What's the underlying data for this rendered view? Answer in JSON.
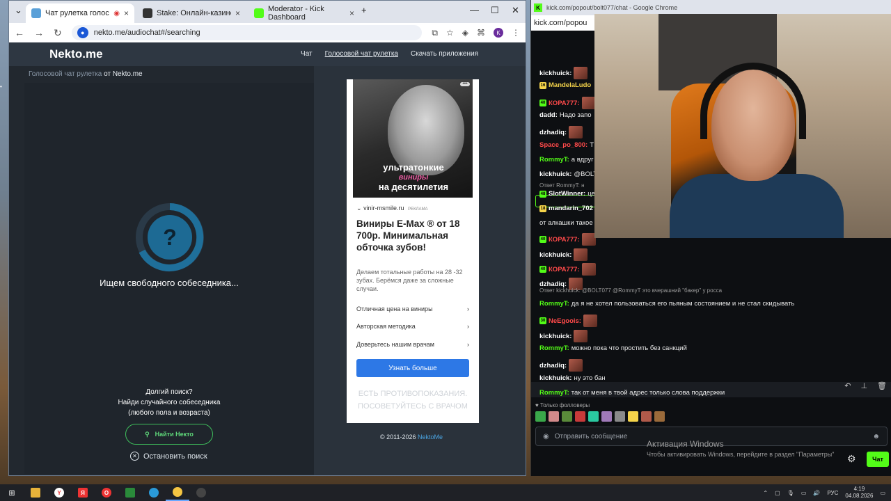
{
  "browser": {
    "tabs": [
      {
        "title": "Чат рулетка голосовая — ...",
        "favicon_color": "#5aa0d8"
      },
      {
        "title": "Stake: Онлайн-казино и ставк...",
        "favicon_color": "#333333"
      },
      {
        "title": "Moderator - Kick Dashboard",
        "favicon_color": "#53fc18"
      }
    ],
    "url": "nekto.me/audiochat#/searching"
  },
  "site": {
    "logo": "Nekto.me",
    "nav": [
      "Чат",
      "Голосовой чат рулетка",
      "Скачать приложения"
    ],
    "breadcrumb_link": "Голосовой чат рулетка",
    "breadcrumb_rest": "от Nekto.me",
    "searching_text": "Ищем свободного собеседника...",
    "long_search": [
      "Долгий поиск?",
      "Найди случайного собеседника",
      "(любого пола и возраста)"
    ],
    "find_button": "Найти Некто",
    "stop_button": "Остановить поиск",
    "copyright_prefix": "© 2011-2026",
    "copyright_brand": "NektoMe"
  },
  "ad": {
    "image_title_1": "ультратонкие",
    "image_title_pink": "виниры",
    "image_title_2": "на десятилетия",
    "domain": "vinir-msmile.ru",
    "ad_tag": "РЕКЛАМА",
    "title": "Виниры E-Max ® от 18 700р. Минимальная обточка зубов!",
    "description": "Делаем тотальные работы на 28 -32 зубах. Берёмся даже за сложные случаи.",
    "rows": [
      "Отличная цена на виниры",
      "Авторская методика",
      "Доверьтесь нашим врачам"
    ],
    "button": "Узнать больше",
    "warning": "ЕСТЬ ПРОТИВОПОКАЗАНИЯ. ПОСОВЕТУЙТЕСЬ С ВРАЧОМ"
  },
  "kick": {
    "window_title": "kick.com/popout/bolt077/chat - Google Chrome",
    "url": "kick.com/popou",
    "messages": [
      {
        "user": "kickhuick:",
        "text": "",
        "color": "#ffffff",
        "emote": true
      },
      {
        "user": "MandelaLudo",
        "text": "",
        "color": "#f5d44a",
        "badge": "16",
        "badge_color": "#f5d44a"
      },
      {
        "user": "КОРА777:",
        "text": "",
        "color": "#ff4a4a",
        "badge": "40",
        "badge_color": "#53fc18",
        "emote": true
      },
      {
        "user": "dadd:",
        "text": "Надо запо",
        "color": "#ffffff"
      },
      {
        "user": "dzhadiq:",
        "text": "",
        "color": "#ffffff",
        "emote": true
      },
      {
        "user": "Space_po_800:",
        "text": "Т",
        "color": "#ff4a4a"
      },
      {
        "user": "RommyT:",
        "text": "а вдруг",
        "color": "#53fc18"
      },
      {
        "user": "kickhuick:",
        "text": "@BOLT",
        "color": "#ffffff"
      },
      {
        "user": "SlotWinner:",
        "text": "це",
        "color": "#ffffff",
        "badge": "48",
        "badge_color": "#53fc18"
      },
      {
        "user": "mandarin_702",
        "text": "",
        "color": "#ffffff",
        "badge": "18",
        "badge_color": "#f5d44a"
      },
      {
        "user": "",
        "text": "от алкашки такое",
        "color": "#ffffff"
      },
      {
        "user": "КОРА777:",
        "text": "",
        "color": "#ff4a4a",
        "badge": "40",
        "badge_color": "#53fc18",
        "emote": true
      },
      {
        "user": "kickhuick:",
        "text": "",
        "color": "#ffffff",
        "emote": true
      },
      {
        "user": "КОРА777:",
        "text": "",
        "color": "#ff4a4a",
        "badge": "40",
        "badge_color": "#53fc18",
        "emote": true
      },
      {
        "user": "dzhadiq:",
        "text": "",
        "color": "#ffffff",
        "emote": true
      },
      {
        "user": "RommyT:",
        "text": "да я не хотел пользоваться его пьяным состоянием и не стал скидывать",
        "color": "#53fc18"
      },
      {
        "user": "NeEgoois:",
        "text": "",
        "color": "#ff4a4a",
        "badge": "30",
        "badge_color": "#53fc18",
        "emote": true
      },
      {
        "user": "kickhuick:",
        "text": "",
        "color": "#ffffff",
        "emote": true
      },
      {
        "user": "RommyT:",
        "text": "можно пока что простить без санкций",
        "color": "#53fc18"
      },
      {
        "user": "dzhadiq:",
        "text": "",
        "color": "#ffffff",
        "emote": true
      },
      {
        "user": "kickhuick:",
        "text": "ну это бан",
        "color": "#ffffff"
      },
      {
        "user": "RommyT:",
        "text": "так от меня в твой адрес только слова поддержки",
        "color": "#53fc18"
      }
    ],
    "reply_1": "Ответ RommyT: н",
    "reply_2": "Ответ kickhuick: @BOLT077 @RommyT это вчерашний \"бакер\" у росса",
    "followers_only": "Только фолловеры",
    "input_placeholder": "Отправить сообщение",
    "send_label": "Чат",
    "activation_title": "Активация Windows",
    "activation_text": "Чтобы активировать Windows, перейдите в раздел \"Параметры\""
  },
  "taskbar": {
    "lang": "РУС",
    "time": "4:19",
    "date": "04.08.2026"
  }
}
